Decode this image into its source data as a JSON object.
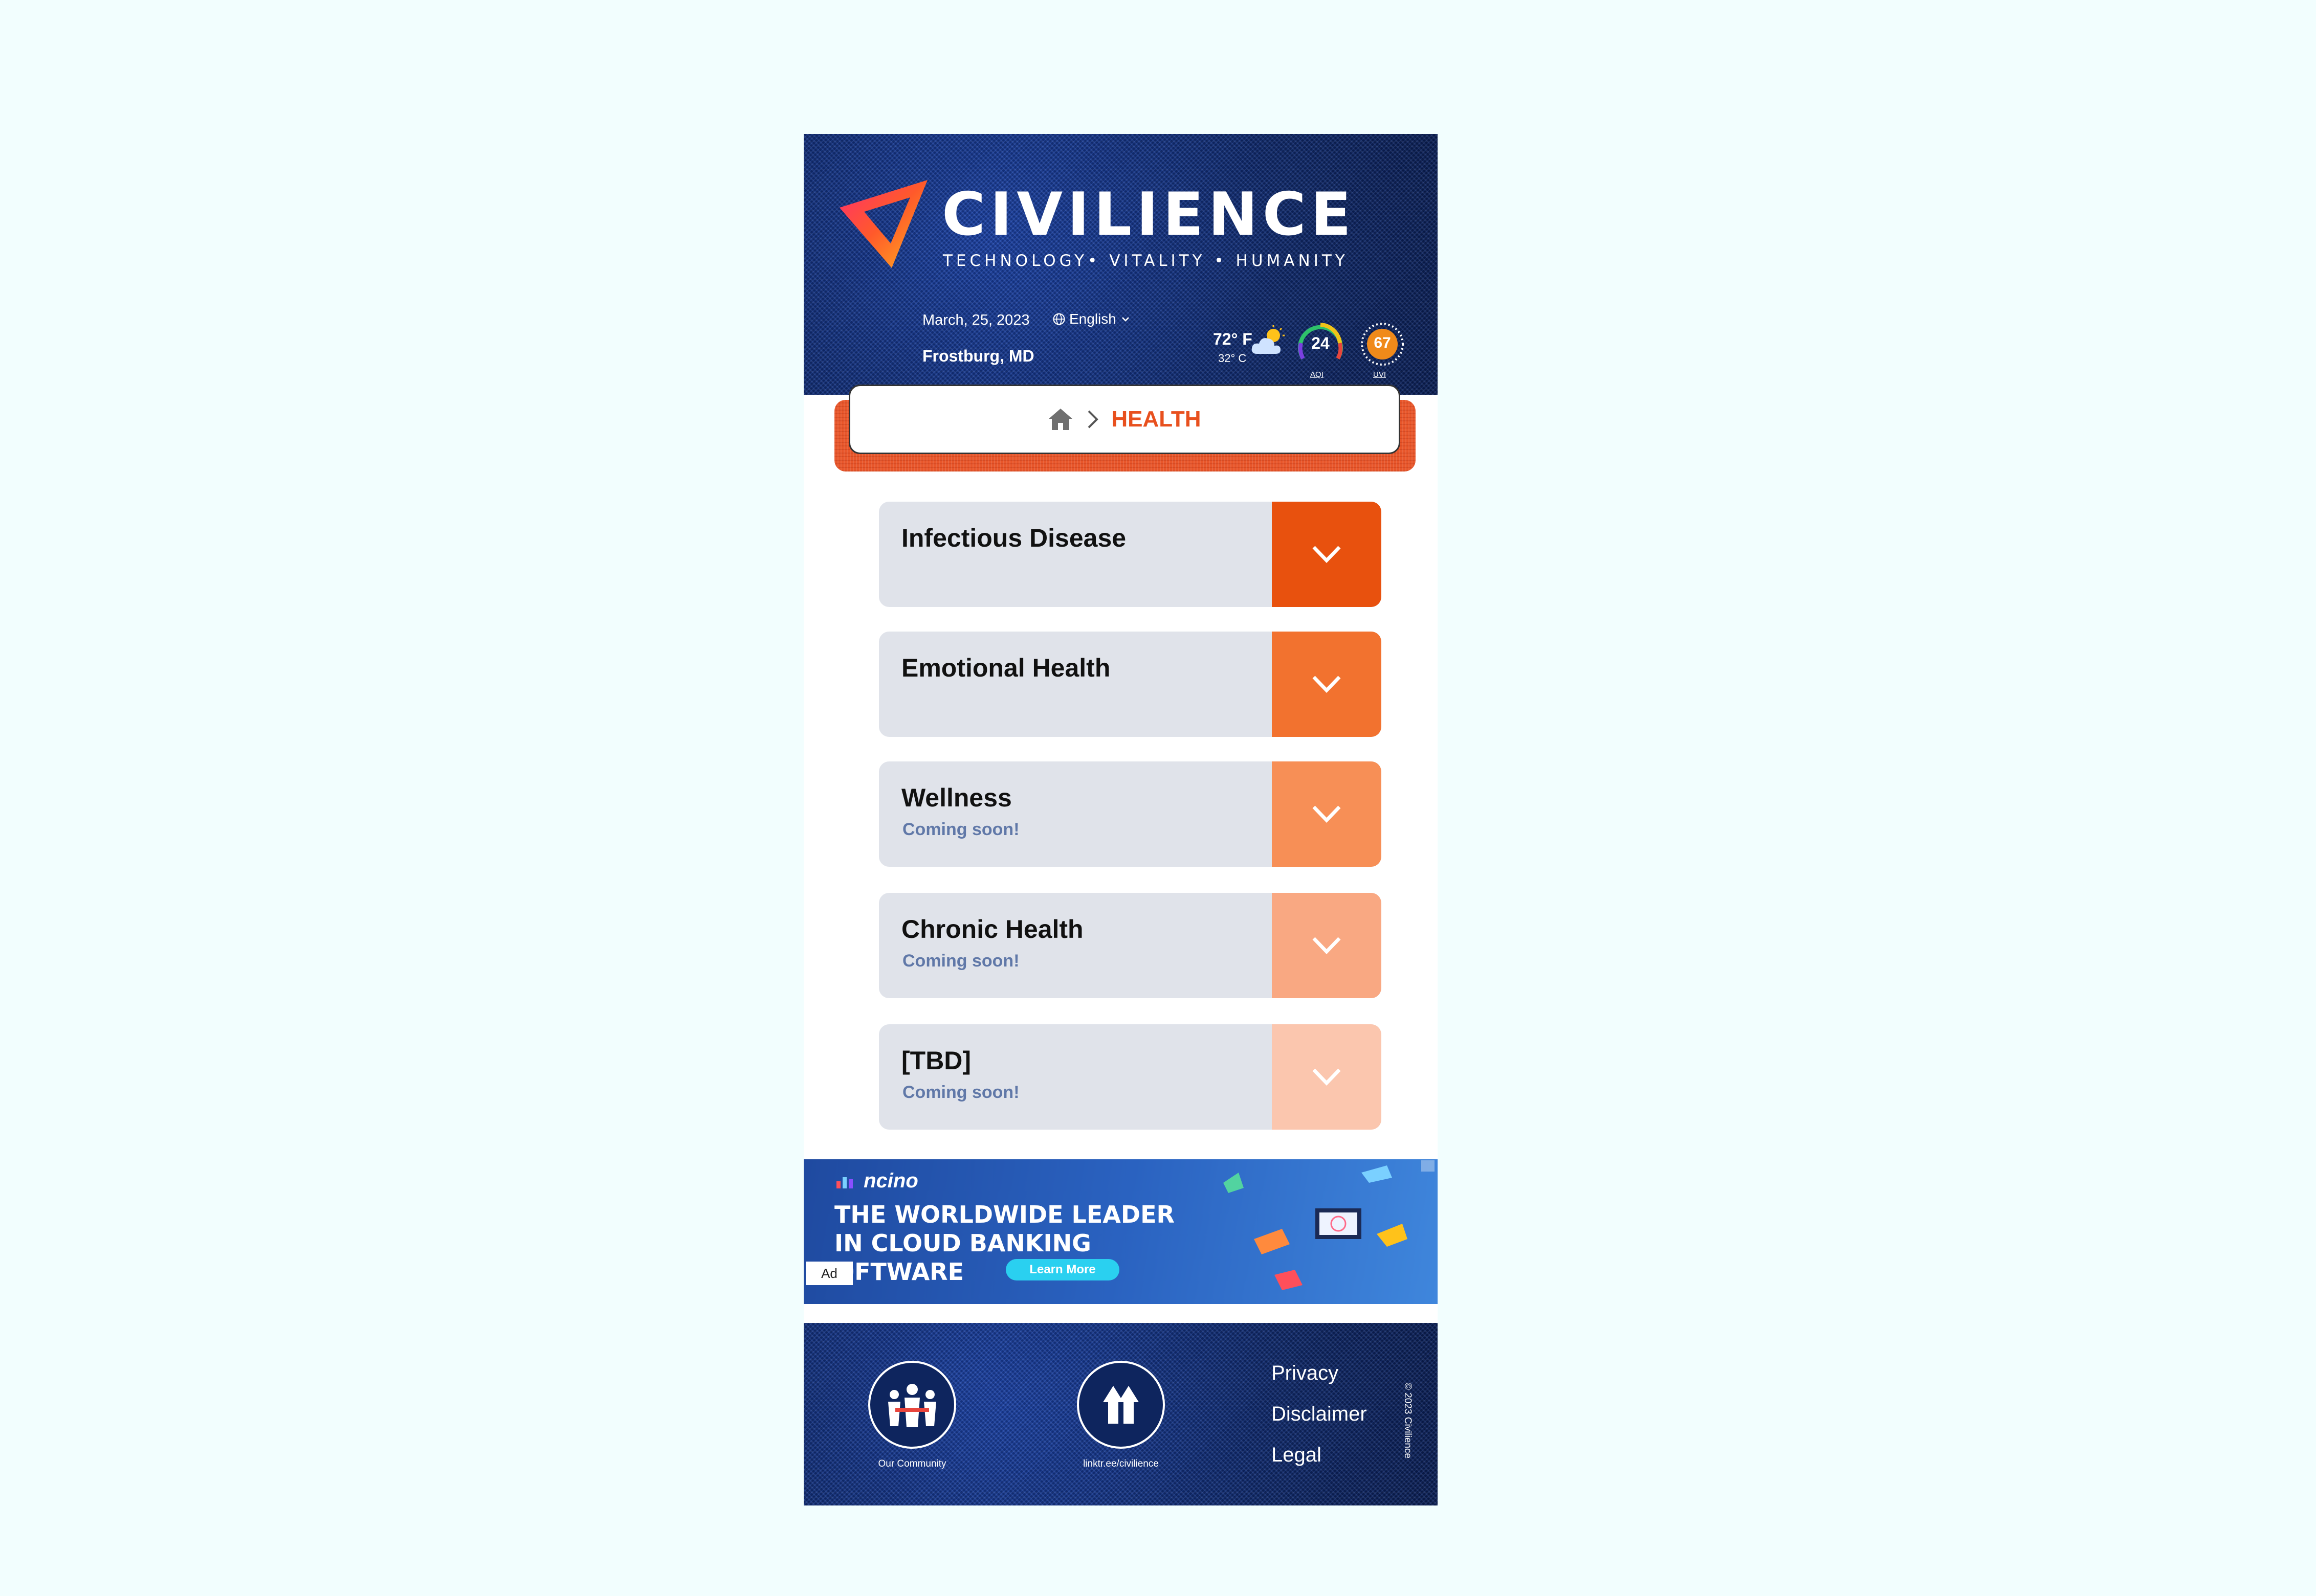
{
  "header": {
    "brand": "CIVILIENCE",
    "tagline": "TECHNOLOGY• VITALITY • HUMANITY",
    "date": "March, 25, 2023",
    "language": "English",
    "location": "Frostburg, MD",
    "temp_f": "72° F",
    "temp_c": "32° C",
    "aqi_value": "24",
    "aqi_label": "AQI",
    "uv_value": "67",
    "uv_label": "UVI"
  },
  "breadcrumb": {
    "current": "HEALTH"
  },
  "categories": [
    {
      "title": "Infectious Disease",
      "subtitle": "",
      "color": "#e8510e"
    },
    {
      "title": "Emotional Health",
      "subtitle": "",
      "color": "#f2722f"
    },
    {
      "title": "Wellness",
      "subtitle": "Coming soon!",
      "color": "#f78f56"
    },
    {
      "title": "Chronic Health",
      "subtitle": "Coming soon!",
      "color": "#f9a882"
    },
    {
      "title": "[TBD]",
      "subtitle": "Coming soon!",
      "color": "#fbc6ae"
    }
  ],
  "ad": {
    "brand": "ncino",
    "headline_1": "THE WORLDWIDE LEADER",
    "headline_2": "IN CLOUD BANKING",
    "headline_3": "OFTWARE",
    "cta": "Learn More",
    "tag": "Ad"
  },
  "footer": {
    "community_label": "Our Community",
    "linktree_label": "linktr.ee/civilience",
    "links": [
      "Privacy",
      "Disclaimer",
      "Legal"
    ],
    "copyright": "© 2023 Civilience"
  },
  "colors": {
    "accent": "#e8501e",
    "navy": "#12307a",
    "card": "#e0e3ea",
    "subtext": "#6078a8"
  }
}
